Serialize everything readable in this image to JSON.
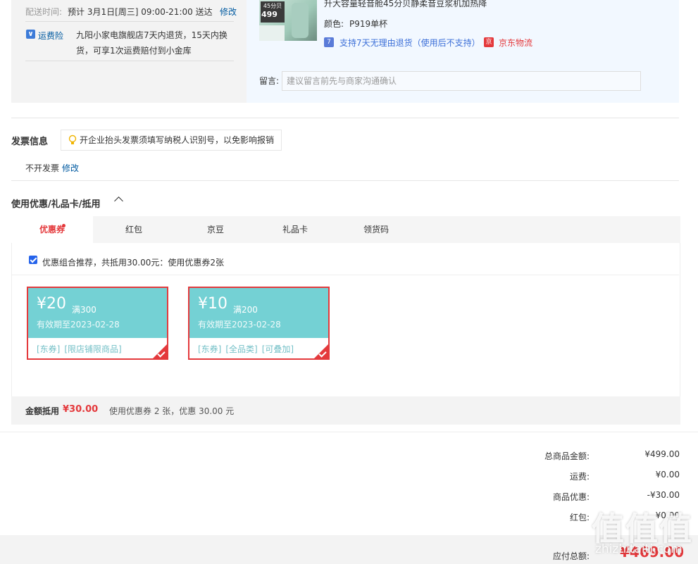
{
  "delivery": {
    "label": "配送时间:",
    "value": "预计 3月1日[周三] 09:00-21:00 送达",
    "edit": "修改"
  },
  "insurance": {
    "icon": "shield-icon",
    "label": "运费险",
    "line1": "九阳小家电旗舰店7天内退货，15天内换",
    "line2": "货，可享1次运费赔付到小金库"
  },
  "product": {
    "image_tag": "45分贝",
    "image_price": "499",
    "title": "升大容量轻音舱45分贝静柔音豆浆机加热降",
    "color_label": "颜色:",
    "color_value": "P919单杯",
    "service_badge": "7",
    "service_text": "支持7天无理由退货（使用后不支持）",
    "logistics_badge": "京",
    "logistics_text": "京东物流"
  },
  "message": {
    "label": "留言:",
    "placeholder": "建议留言前先与商家沟通确认"
  },
  "invoice": {
    "title": "发票信息",
    "tip": "开企业抬头发票须填写纳税人识别号，以免影响报销",
    "value": "不开发票",
    "edit": "修改"
  },
  "discount": {
    "title": "使用优惠/礼品卡/抵用",
    "tabs": [
      "优惠券",
      "红包",
      "京豆",
      "礼品卡",
      "领货码"
    ],
    "recommend": "优惠组合推荐，共抵用30.00元：使用优惠券2张",
    "coupons": [
      {
        "amount": "¥20",
        "condition": "满300",
        "valid": "有效期至2023-02-28",
        "tags": [
          "[东券]",
          "[限店铺限商品]"
        ]
      },
      {
        "amount": "¥10",
        "condition": "满200",
        "valid": "有效期至2023-02-28",
        "tags": [
          "[东券]",
          "[全品类]",
          "[可叠加]"
        ]
      }
    ],
    "summary_label": "金额抵用",
    "summary_amount": "¥30.00",
    "summary_text": "使用优惠券 2 张，优惠 30.00 元"
  },
  "fees": [
    {
      "label": "总商品金额:",
      "value": "¥499.00"
    },
    {
      "label": "运费:",
      "value": "¥0.00"
    },
    {
      "label": "商品优惠:",
      "value": "-¥30.00"
    },
    {
      "label": "红包:",
      "value": "¥0.00"
    }
  ],
  "total": {
    "label": "应付总额:",
    "value": "¥469.00"
  },
  "watermark": {
    "logo": "值值值",
    "site": "zhizhitaiti.com"
  },
  "colors": {
    "accent": "#e4393c",
    "coupon_bg": "#74d1d4",
    "link": "#005aa0"
  }
}
